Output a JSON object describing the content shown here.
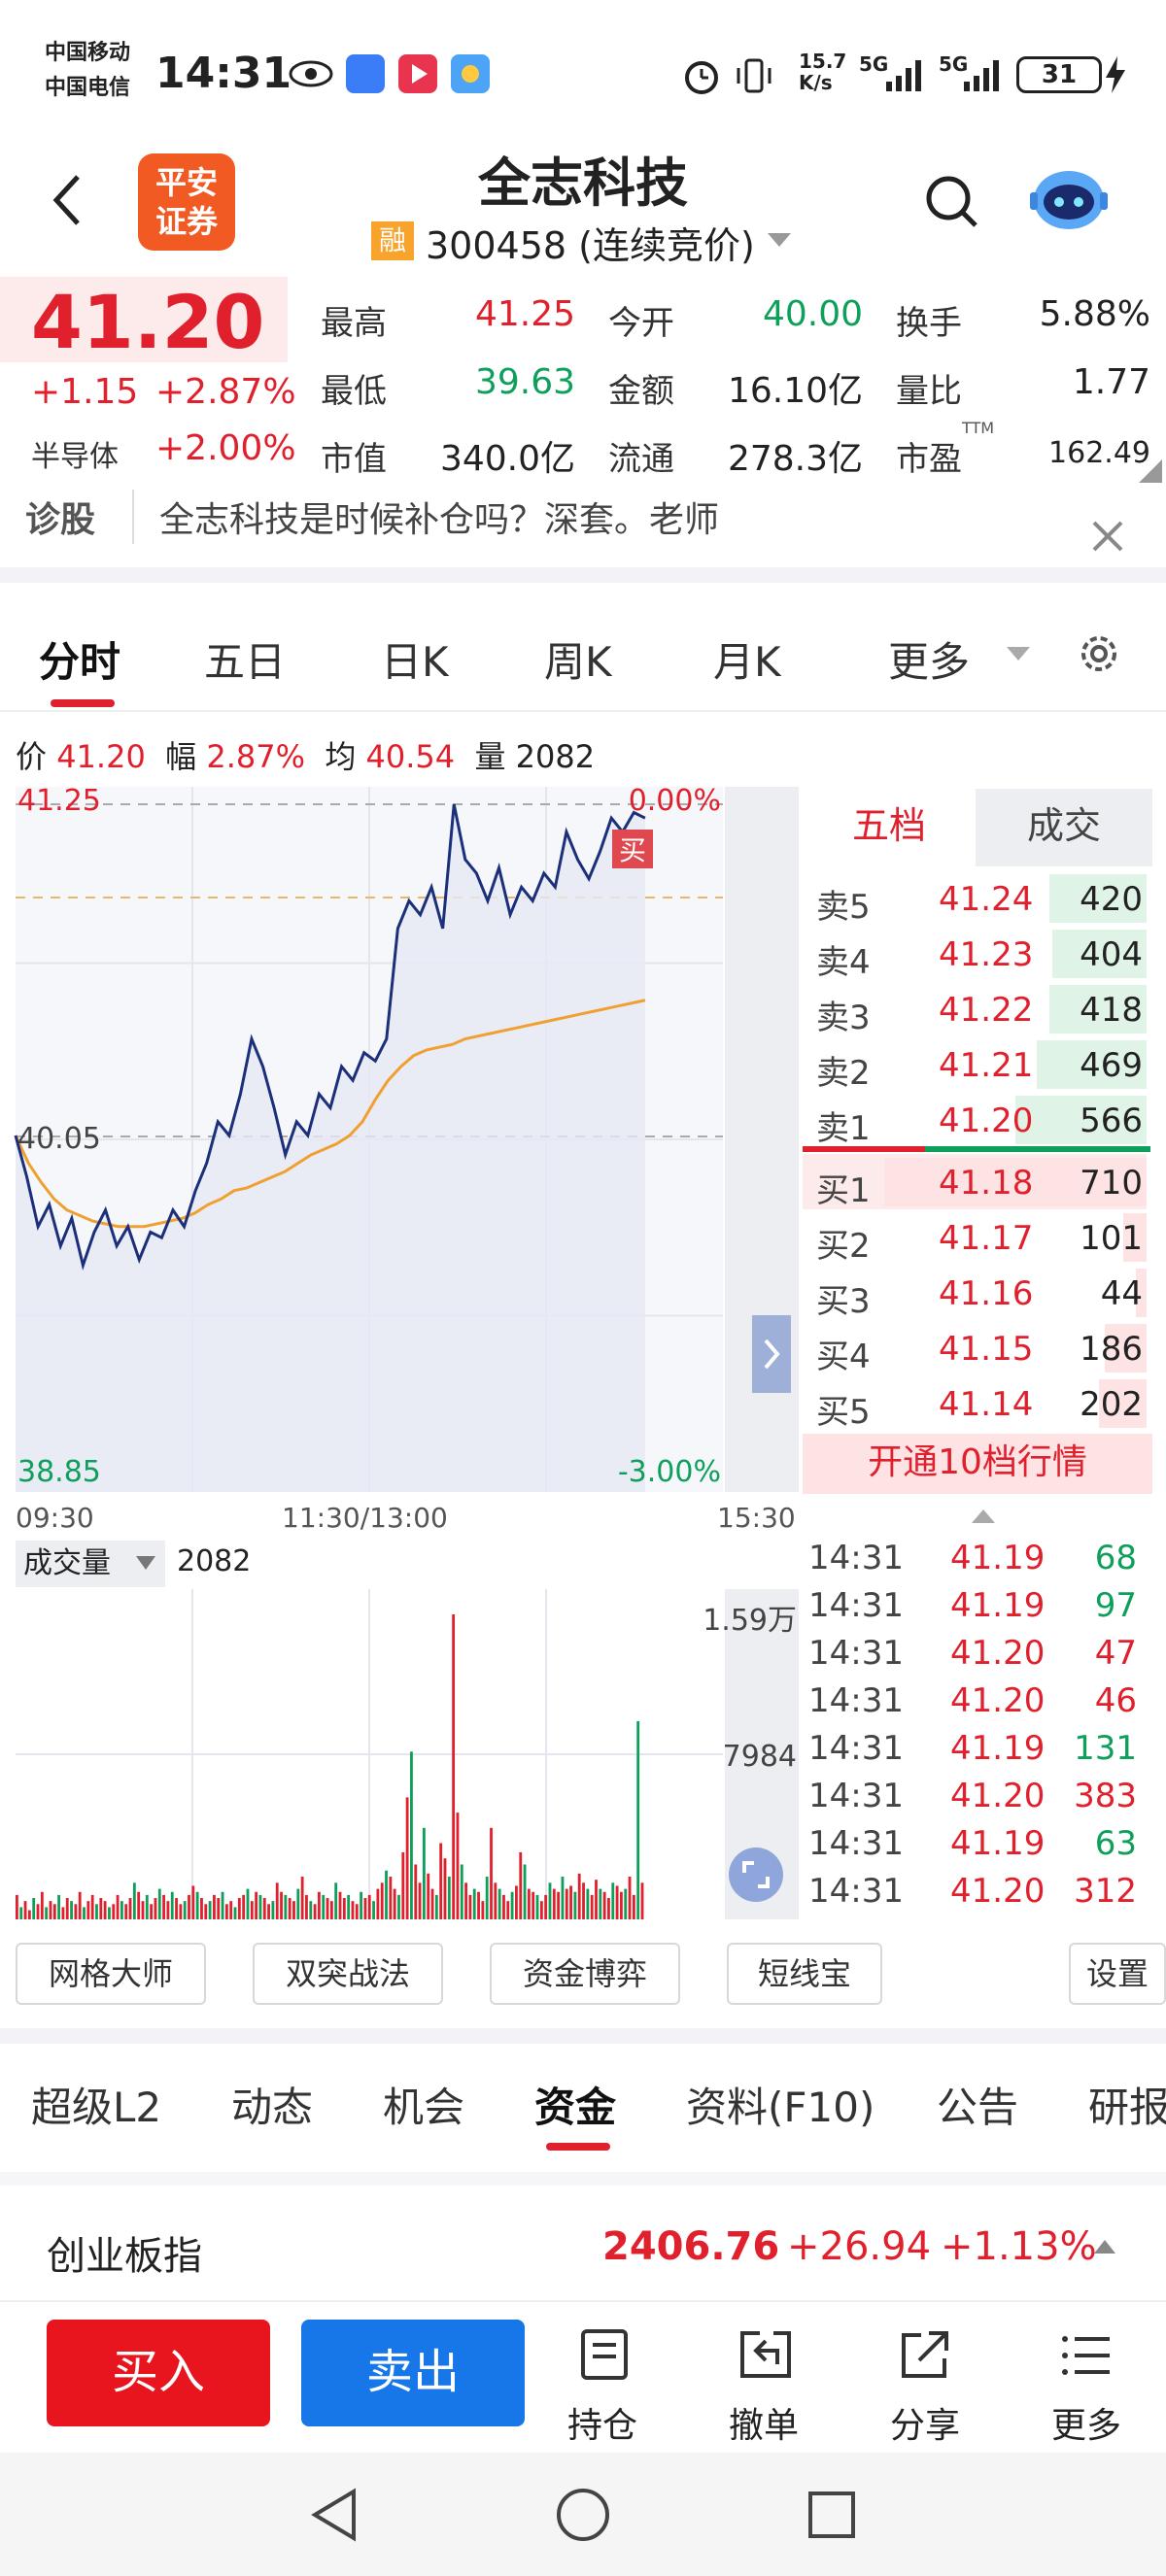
{
  "status_bar": {
    "carrier1": "中国移动",
    "carrier2": "中国电信",
    "time": "14:31",
    "net_speed_top": "15.7",
    "net_speed_bottom": "K/s",
    "signal1": "5G",
    "signal2": "5G",
    "battery": "31"
  },
  "header": {
    "logo_line1": "平安",
    "logo_line2": "证券",
    "title": "全志科技",
    "badge": "融",
    "code_label": "300458 (连续竞价)"
  },
  "quote": {
    "price": "41.20",
    "change": "+1.15",
    "change_pct": "+2.87%",
    "sector": "半导体",
    "sector_pct": "+2.00%",
    "fields": [
      {
        "label": "最高",
        "value": "41.25",
        "color": "red"
      },
      {
        "label": "今开",
        "value": "40.00",
        "color": "green"
      },
      {
        "label": "换手",
        "value": "5.88%",
        "color": "black"
      },
      {
        "label": "最低",
        "value": "39.63",
        "color": "green"
      },
      {
        "label": "金额",
        "value": "16.10亿",
        "color": "black"
      },
      {
        "label": "量比",
        "value": "1.77",
        "color": "black"
      },
      {
        "label": "市值",
        "value": "340.0亿",
        "color": "black"
      },
      {
        "label": "流通",
        "value": "278.3亿",
        "color": "black"
      },
      {
        "label": "市盈",
        "value": "162.49",
        "color": "black"
      }
    ],
    "pe_superscript": "TTM"
  },
  "news": {
    "tag": "诊股",
    "text": "全志科技是时候补仓吗？深套。老师"
  },
  "chart_tabs": [
    "分时",
    "五日",
    "日K",
    "周K",
    "月K",
    "更多"
  ],
  "chart_info": {
    "price_label": "价",
    "price": "41.20",
    "range_label": "幅",
    "range": "2.87%",
    "avg_label": "均",
    "avg": "40.54",
    "vol_label": "量",
    "vol": "2082"
  },
  "chart_labels": {
    "y_top": "41.25",
    "y_mid": "40.05",
    "y_bottom": "38.85",
    "pct_top": "0.00%",
    "pct_bottom": "-3.00%",
    "buy_marker": "买",
    "x_start": "09:30",
    "x_mid": "11:30/13:00",
    "x_end": "15:30",
    "vol_selector": "成交量",
    "vol_value": "2082",
    "vol_top": "1.59万",
    "vol_mid": "7984"
  },
  "chart_data": {
    "type": "line",
    "series": [
      {
        "values": [
          40.05,
          39.9,
          39.72,
          39.8,
          39.65,
          39.75,
          39.58,
          39.7,
          39.78,
          39.65,
          39.72,
          39.6,
          39.7,
          39.68,
          39.78,
          39.72,
          39.85,
          39.95,
          40.1,
          40.05,
          40.2,
          40.4,
          40.3,
          40.15,
          39.98,
          40.1,
          40.05,
          40.2,
          40.15,
          40.3,
          40.25,
          40.35,
          40.32,
          40.4,
          40.8,
          40.9,
          40.85,
          40.95,
          40.8,
          41.25,
          41.05,
          41.0,
          40.9,
          41.02,
          40.85,
          40.95,
          40.9,
          41.0,
          40.95,
          41.15,
          41.05,
          40.98,
          41.08,
          41.2,
          41.15,
          41.22,
          41.2
        ]
      },
      {
        "values": [
          40.05,
          39.95,
          39.88,
          39.82,
          39.78,
          39.76,
          39.74,
          39.73,
          39.72,
          39.72,
          39.72,
          39.73,
          39.74,
          39.75,
          39.77,
          39.8,
          39.82,
          39.85,
          39.86,
          39.88,
          39.9,
          39.92,
          39.95,
          39.98,
          40.0,
          40.02,
          40.05,
          40.1,
          40.18,
          40.25,
          40.3,
          40.34,
          40.36,
          40.37,
          40.38,
          40.4,
          40.41,
          40.42,
          40.43,
          40.44,
          40.45,
          40.46,
          40.47,
          40.48,
          40.49,
          40.5,
          40.51,
          40.52,
          40.53,
          40.54
        ]
      }
    ],
    "ylim": [
      38.85,
      41.25
    ],
    "volume": [
      8,
      4,
      6,
      3,
      7,
      5,
      9,
      4,
      6,
      5,
      8,
      4,
      7,
      6,
      5,
      9,
      4,
      6,
      8,
      5,
      7,
      6,
      4,
      5,
      8,
      6,
      5,
      7,
      12,
      9,
      6,
      8,
      5,
      7,
      10,
      8,
      6,
      9,
      7,
      5,
      6,
      8,
      11,
      9,
      7,
      5,
      6,
      8,
      7,
      9,
      5,
      6,
      4,
      7,
      8,
      10,
      6,
      9,
      8,
      7,
      5,
      6,
      12,
      9,
      8,
      7,
      6,
      10,
      14,
      8,
      6,
      5,
      9,
      8,
      7,
      6,
      12,
      9,
      7,
      8,
      6,
      5,
      9,
      7,
      8,
      6,
      10,
      12,
      16,
      14,
      10,
      8,
      22,
      40,
      55,
      18,
      12,
      30,
      15,
      10,
      8,
      25,
      20,
      14,
      100,
      35,
      18,
      12,
      8,
      10,
      9,
      6,
      14,
      30,
      12,
      10,
      8,
      6,
      9,
      11,
      22,
      18,
      10,
      9,
      8,
      6,
      8,
      12,
      10,
      9,
      14,
      10,
      11,
      9,
      15,
      12,
      10,
      8,
      13,
      10,
      9,
      7,
      12,
      11,
      9,
      10,
      14,
      8,
      65,
      12
    ],
    "volume_ylim": [
      0,
      15900
    ]
  },
  "order_book": {
    "tabs": [
      "五档",
      "成交"
    ],
    "asks": [
      {
        "label": "卖5",
        "price": "41.24",
        "vol": "420",
        "fill": 0.37
      },
      {
        "label": "卖4",
        "price": "41.23",
        "vol": "404",
        "fill": 0.36
      },
      {
        "label": "卖3",
        "price": "41.22",
        "vol": "418",
        "fill": 0.37
      },
      {
        "label": "卖2",
        "price": "41.21",
        "vol": "469",
        "fill": 0.42
      },
      {
        "label": "卖1",
        "price": "41.20",
        "vol": "566",
        "fill": 0.5
      }
    ],
    "bids": [
      {
        "label": "买1",
        "price": "41.18",
        "vol": "710",
        "fill": 1.0
      },
      {
        "label": "买2",
        "price": "41.17",
        "vol": "101",
        "fill": 0.09
      },
      {
        "label": "买3",
        "price": "41.16",
        "vol": "44",
        "fill": 0.04
      },
      {
        "label": "买4",
        "price": "41.15",
        "vol": "186",
        "fill": 0.16
      },
      {
        "label": "买5",
        "price": "41.14",
        "vol": "202",
        "fill": 0.18
      }
    ],
    "upgrade_label": "开通10档行情"
  },
  "trades": [
    {
      "time": "14:31",
      "price": "41.19",
      "vol": "68",
      "side": "green"
    },
    {
      "time": "14:31",
      "price": "41.19",
      "vol": "97",
      "side": "green"
    },
    {
      "time": "14:31",
      "price": "41.20",
      "vol": "47",
      "side": "red"
    },
    {
      "time": "14:31",
      "price": "41.20",
      "vol": "46",
      "side": "red"
    },
    {
      "time": "14:31",
      "price": "41.19",
      "vol": "131",
      "side": "green"
    },
    {
      "time": "14:31",
      "price": "41.20",
      "vol": "383",
      "side": "red"
    },
    {
      "time": "14:31",
      "price": "41.19",
      "vol": "63",
      "side": "green"
    },
    {
      "time": "14:31",
      "price": "41.20",
      "vol": "312",
      "side": "red"
    }
  ],
  "tools": [
    "网格大师",
    "双突战法",
    "资金博弈",
    "短线宝",
    "设置"
  ],
  "bottom_tabs": [
    "超级L2",
    "动态",
    "机会",
    "资金",
    "资料(F10)",
    "公告",
    "研报"
  ],
  "index": {
    "name": "创业板指",
    "value": "2406.76",
    "change": "+26.94",
    "pct": "+1.13%"
  },
  "actions": {
    "buy": "买入",
    "sell": "卖出",
    "items": [
      {
        "label": "持仓",
        "icon": "holdings-icon"
      },
      {
        "label": "撤单",
        "icon": "cancel-order-icon"
      },
      {
        "label": "分享",
        "icon": "share-icon"
      },
      {
        "label": "更多",
        "icon": "more-icon"
      }
    ]
  }
}
